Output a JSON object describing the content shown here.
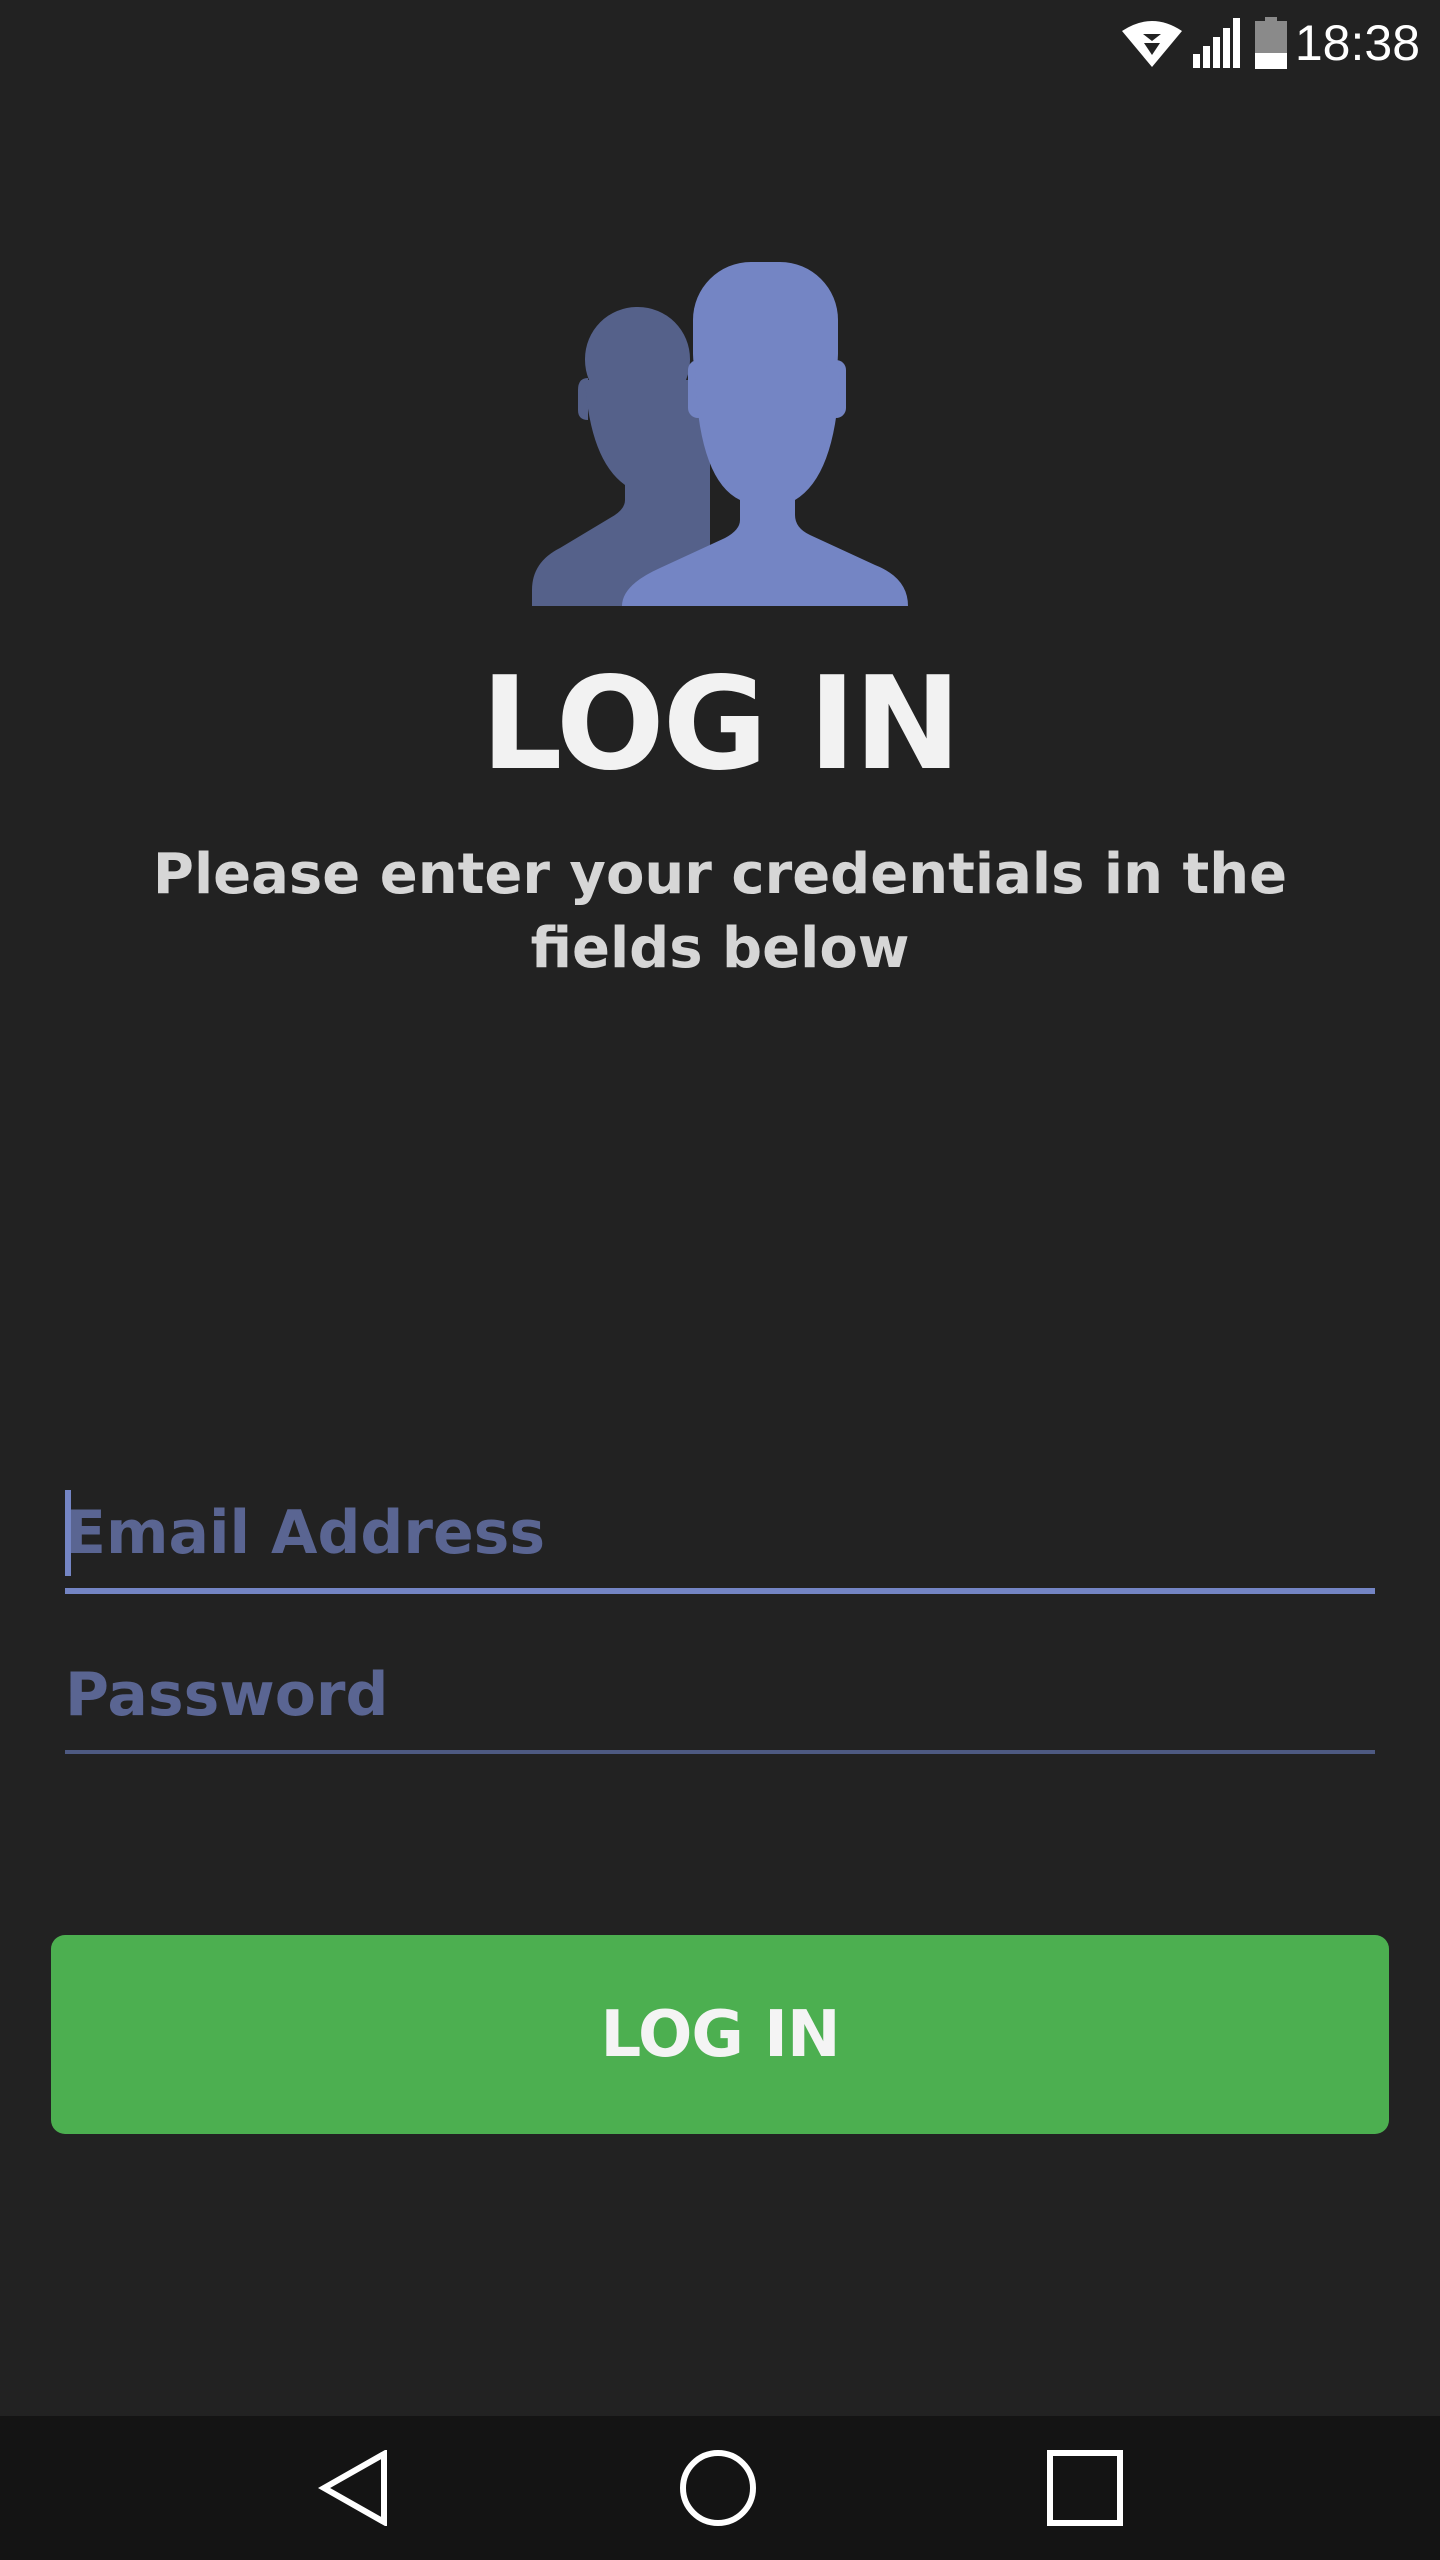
{
  "status_bar": {
    "time": "18:38",
    "icons": [
      "wifi-icon",
      "cell-signal-icon",
      "battery-icon"
    ]
  },
  "header": {
    "icon": "users-icon",
    "title": "LOG IN",
    "subtitle": "Please enter your credentials in the fields below"
  },
  "form": {
    "email": {
      "value": "",
      "placeholder": "Email Address",
      "focused": true
    },
    "password": {
      "value": "",
      "placeholder": "Password",
      "focused": false
    },
    "submit_label": "LOG IN"
  },
  "nav_bar": {
    "buttons": [
      "back-icon",
      "home-icon",
      "recents-icon"
    ]
  },
  "colors": {
    "background": "#222222",
    "accent": "#7485c4",
    "accent_dim": "#55618a",
    "button": "#4caf50",
    "nav_background": "#141414"
  }
}
